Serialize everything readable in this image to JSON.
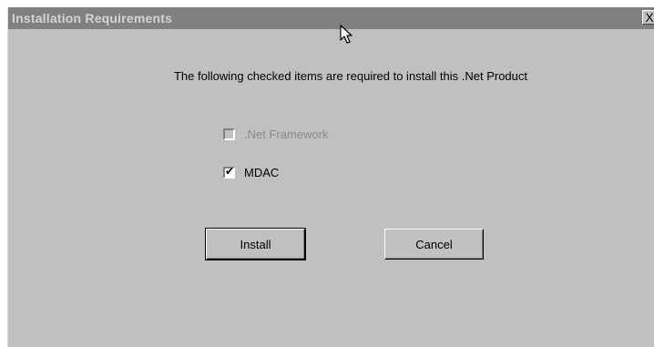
{
  "window": {
    "title": "Installation Requirements",
    "close_glyph": "X"
  },
  "message": "The following checked items are required to install this .Net Product",
  "requirements": [
    {
      "label": ".Net Framework",
      "checked": false,
      "enabled": false
    },
    {
      "label": "MDAC",
      "checked": true,
      "enabled": true
    }
  ],
  "buttons": {
    "install_label": "Install",
    "cancel_label": "Cancel"
  },
  "icons": {
    "close": "close-icon",
    "check": "checkmark-icon",
    "cursor": "mouse-pointer-icon"
  },
  "colors": {
    "face": "#c0c0c0",
    "titlebar": "#808080",
    "disabled_text": "#8a8a8a"
  }
}
